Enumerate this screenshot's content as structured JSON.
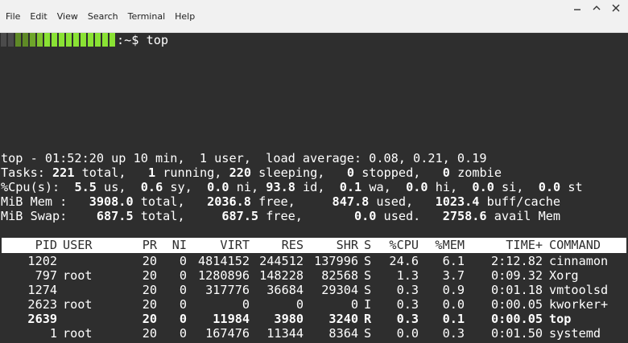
{
  "menubar": {
    "items": [
      "File",
      "Edit",
      "View",
      "Search",
      "Terminal",
      "Help"
    ]
  },
  "colors": {
    "background": "#2e2e2e",
    "text": "#ffffff",
    "prompt_bar_green": "#8ae234",
    "prompt_bar_dark": "#5f8a26",
    "header_bg": "#ffffff"
  },
  "prompt": {
    "suffix": ":~$ top"
  },
  "summary": {
    "line1": "top - 01:52:20 up 10 min,  1 user,  load average: 0.08, 0.21, 0.19",
    "tasks": {
      "label": "Tasks:",
      "total": "221",
      "total_label": "total,",
      "running": "1",
      "running_label": "running,",
      "sleeping": "220",
      "sleeping_label": "sleeping,",
      "stopped": "0",
      "stopped_label": "stopped,",
      "zombie": "0",
      "zombie_label": "zombie"
    },
    "cpu": {
      "label": "%Cpu(s):",
      "us": "5.5",
      "us_label": "us,",
      "sy": "0.6",
      "sy_label": "sy,",
      "ni": "0.0",
      "ni_label": "ni,",
      "id": "93.8",
      "id_label": "id,",
      "wa": "0.1",
      "wa_label": "wa,",
      "hi": "0.0",
      "hi_label": "hi,",
      "si": "0.0",
      "si_label": "si,",
      "st": "0.0",
      "st_label": "st"
    },
    "mem": {
      "label": "MiB Mem :",
      "total": "3908.0",
      "total_label": "total,",
      "free": "2036.8",
      "free_label": "free,",
      "used": "847.8",
      "used_label": "used,",
      "buff": "1023.4",
      "buff_label": "buff/cache"
    },
    "swap": {
      "label": "MiB Swap:",
      "total": "687.5",
      "total_label": "total,",
      "free": "687.5",
      "free_label": "free,",
      "used": "0.0",
      "used_label": "used.",
      "avail": "2758.6",
      "avail_label": "avail Mem"
    }
  },
  "table": {
    "columns": [
      "PID",
      "USER",
      "PR",
      "NI",
      "VIRT",
      "RES",
      "SHR",
      "S",
      "%CPU",
      "%MEM",
      "TIME+",
      "COMMAND"
    ],
    "rows": [
      {
        "pid": "1202",
        "user": "",
        "pr": "20",
        "ni": "0",
        "virt": "4814152",
        "res": "244512",
        "shr": "137996",
        "s": "S",
        "cpu": "24.6",
        "mem": "6.1",
        "time": "2:12.82",
        "command": "cinnamon",
        "bold": false
      },
      {
        "pid": "797",
        "user": "root",
        "pr": "20",
        "ni": "0",
        "virt": "1280896",
        "res": "148228",
        "shr": "82568",
        "s": "S",
        "cpu": "1.3",
        "mem": "3.7",
        "time": "0:09.32",
        "command": "Xorg",
        "bold": false
      },
      {
        "pid": "1274",
        "user": "",
        "pr": "20",
        "ni": "0",
        "virt": "317776",
        "res": "36684",
        "shr": "29304",
        "s": "S",
        "cpu": "0.3",
        "mem": "0.9",
        "time": "0:01.18",
        "command": "vmtoolsd",
        "bold": false
      },
      {
        "pid": "2623",
        "user": "root",
        "pr": "20",
        "ni": "0",
        "virt": "0",
        "res": "0",
        "shr": "0",
        "s": "I",
        "cpu": "0.3",
        "mem": "0.0",
        "time": "0:00.05",
        "command": "kworker+",
        "bold": false
      },
      {
        "pid": "2639",
        "user": "",
        "pr": "20",
        "ni": "0",
        "virt": "11984",
        "res": "3980",
        "shr": "3240",
        "s": "R",
        "cpu": "0.3",
        "mem": "0.1",
        "time": "0:00.05",
        "command": "top",
        "bold": true
      },
      {
        "pid": "1",
        "user": "root",
        "pr": "20",
        "ni": "0",
        "virt": "167476",
        "res": "11344",
        "shr": "8364",
        "s": "S",
        "cpu": "0.0",
        "mem": "0.3",
        "time": "0:01.50",
        "command": "systemd",
        "bold": false
      }
    ]
  }
}
